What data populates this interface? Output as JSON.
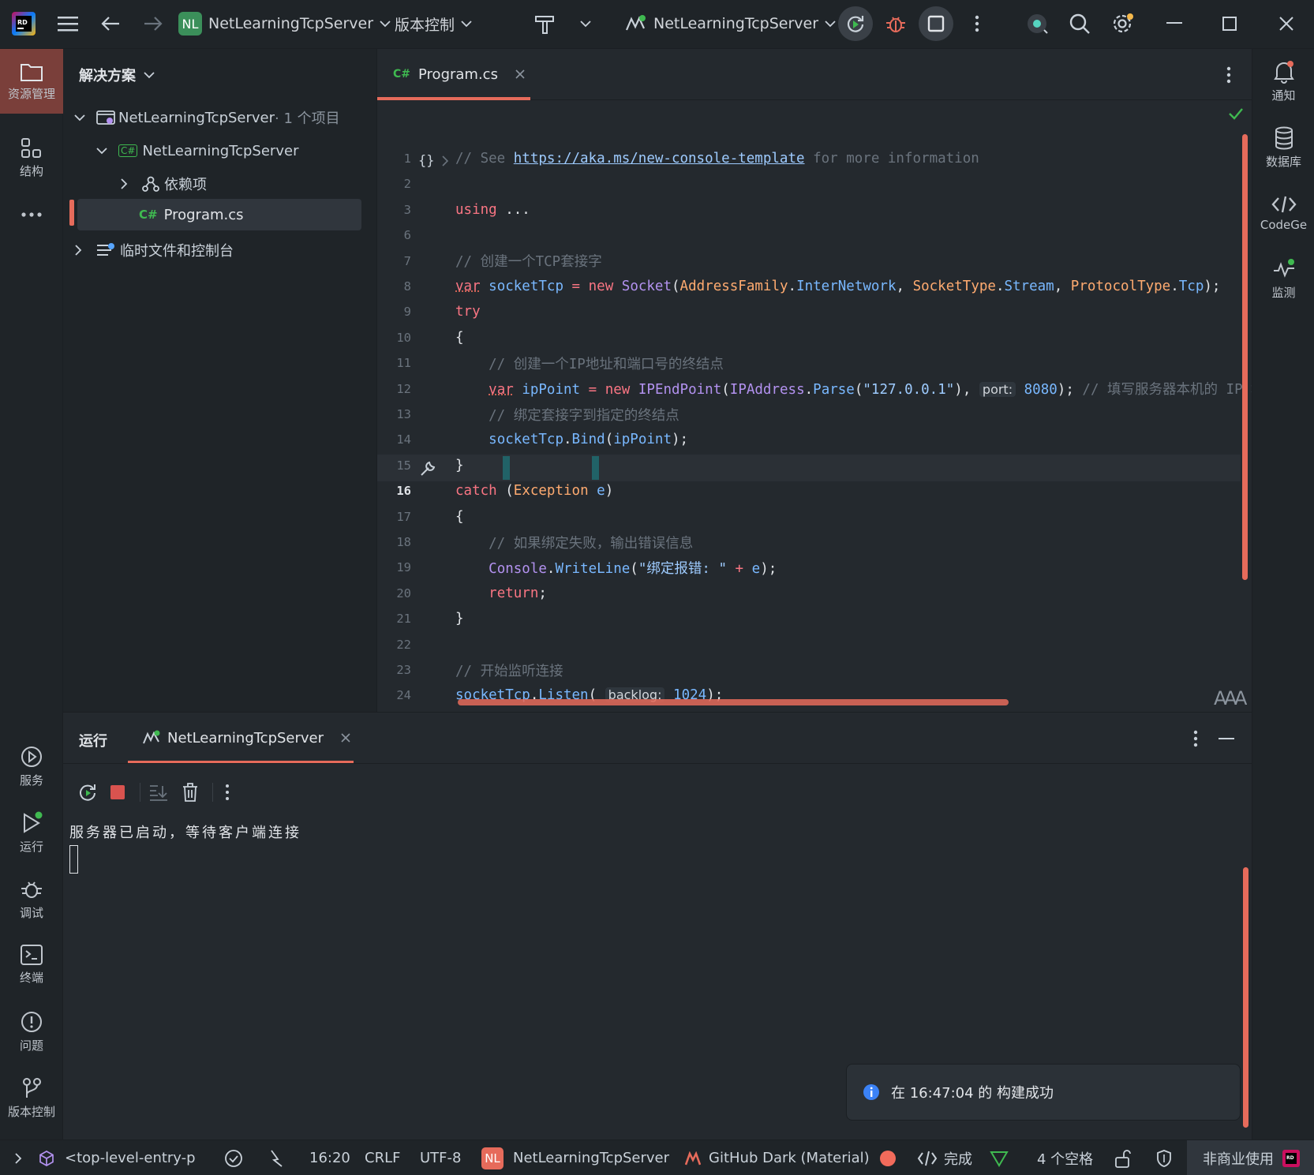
{
  "titlebar": {
    "project_badge": "NL",
    "project_name": "NetLearningTcpServer",
    "vcs_label": "版本控制",
    "run_config": "NetLearningTcpServer"
  },
  "solution": {
    "header": "解决方案",
    "items": [
      {
        "label": "NetLearningTcpServer",
        "suffix": " · 1 个项目"
      },
      {
        "label": "NetLearningTcpServer",
        "badge": "C#"
      },
      {
        "label": "依赖项"
      },
      {
        "label": "Program.cs",
        "badge": "C#"
      },
      {
        "label": "临时文件和控制台"
      }
    ]
  },
  "left_strip": {
    "explorer": "资源管理",
    "structure": "结构",
    "services": "服务",
    "run": "运行",
    "debug": "调试",
    "terminal": "终端",
    "problems": "问题",
    "vcs": "版本控制"
  },
  "right_strip": {
    "notifications": "通知",
    "database": "数据库",
    "codegen": "CodeGe",
    "monitor": "监测"
  },
  "editor": {
    "tab_lang": "C#",
    "tab_label": "Program.cs",
    "current_line": "16",
    "lines": [
      {
        "n": "1",
        "parts": [
          {
            "c": "c-com",
            "t": "// See "
          },
          {
            "c": "c-link",
            "t": "https://aka.ms/new-console-template"
          },
          {
            "c": "c-com",
            "t": " for more information"
          }
        ]
      },
      {
        "n": "2",
        "parts": []
      },
      {
        "n": "3",
        "parts": [
          {
            "c": "c-kw",
            "t": "using"
          },
          {
            "c": "c-plain",
            "t": " ..."
          }
        ]
      },
      {
        "n": "6",
        "parts": []
      },
      {
        "n": "7",
        "parts": [
          {
            "c": "c-com",
            "t": "// 创建一个TCP套接字"
          }
        ]
      },
      {
        "n": "8",
        "parts": [
          {
            "c": "c-kw",
            "t": "var"
          },
          {
            "c": "c-plain",
            "t": " "
          },
          {
            "c": "c-var",
            "t": "socketTcp"
          },
          {
            "c": "c-plain",
            "t": " "
          },
          {
            "c": "c-kw",
            "t": "="
          },
          {
            "c": "c-plain",
            "t": " "
          },
          {
            "c": "c-kw",
            "t": "new"
          },
          {
            "c": "c-plain",
            "t": " "
          },
          {
            "c": "c-type",
            "t": "Socket"
          },
          {
            "c": "c-plain",
            "t": "("
          },
          {
            "c": "c-yel",
            "t": "AddressFamily"
          },
          {
            "c": "c-plain",
            "t": "."
          },
          {
            "c": "c-fn",
            "t": "InterNetwork"
          },
          {
            "c": "c-plain",
            "t": ", "
          },
          {
            "c": "c-yel",
            "t": "SocketType"
          },
          {
            "c": "c-plain",
            "t": "."
          },
          {
            "c": "c-fn",
            "t": "Stream"
          },
          {
            "c": "c-plain",
            "t": ", "
          },
          {
            "c": "c-yel",
            "t": "ProtocolType"
          },
          {
            "c": "c-plain",
            "t": "."
          },
          {
            "c": "c-fn",
            "t": "Tcp"
          },
          {
            "c": "c-plain",
            "t": ");"
          }
        ]
      },
      {
        "n": "9",
        "parts": [
          {
            "c": "c-kw",
            "t": "try"
          }
        ]
      },
      {
        "n": "10",
        "parts": [
          {
            "c": "c-plain",
            "t": "{"
          }
        ]
      },
      {
        "n": "11",
        "parts": [
          {
            "c": "c-com",
            "t": "    // 创建一个IP地址和端口号的终结点"
          }
        ]
      },
      {
        "n": "12",
        "parts": [
          {
            "c": "c-plain",
            "t": "    "
          },
          {
            "c": "c-kw",
            "t": "var"
          },
          {
            "c": "c-plain",
            "t": " "
          },
          {
            "c": "c-var",
            "t": "ipPoint"
          },
          {
            "c": "c-plain",
            "t": " "
          },
          {
            "c": "c-kw",
            "t": "="
          },
          {
            "c": "c-plain",
            "t": " "
          },
          {
            "c": "c-kw",
            "t": "new"
          },
          {
            "c": "c-plain",
            "t": " "
          },
          {
            "c": "c-type",
            "t": "IPEndPoint"
          },
          {
            "c": "c-plain",
            "t": "("
          },
          {
            "c": "c-type",
            "t": "IPAddress"
          },
          {
            "c": "c-plain",
            "t": "."
          },
          {
            "c": "c-fn",
            "t": "Parse"
          },
          {
            "c": "c-plain",
            "t": "("
          },
          {
            "c": "c-str",
            "t": "\"127.0.0.1\""
          },
          {
            "c": "c-plain",
            "t": "), "
          },
          {
            "c": "hint",
            "t": "port:"
          },
          {
            "c": "c-plain",
            "t": " "
          },
          {
            "c": "c-var",
            "t": "8080"
          },
          {
            "c": "c-plain",
            "t": "); "
          },
          {
            "c": "c-com",
            "t": "// 填写服务器本机的 IP 地址"
          }
        ]
      },
      {
        "n": "13",
        "parts": [
          {
            "c": "c-com",
            "t": "    // 绑定套接字到指定的终结点"
          }
        ]
      },
      {
        "n": "14",
        "parts": [
          {
            "c": "c-plain",
            "t": "    "
          },
          {
            "c": "c-var",
            "t": "socketTcp"
          },
          {
            "c": "c-plain",
            "t": "."
          },
          {
            "c": "c-fn",
            "t": "Bind"
          },
          {
            "c": "c-plain",
            "t": "("
          },
          {
            "c": "c-var",
            "t": "ipPoint"
          },
          {
            "c": "c-plain",
            "t": ");"
          }
        ]
      },
      {
        "n": "15",
        "parts": [
          {
            "c": "c-plain",
            "t": "}"
          }
        ]
      },
      {
        "n": "16",
        "parts": [
          {
            "c": "c-kw",
            "t": "catch"
          },
          {
            "c": "c-plain",
            "t": " "
          },
          {
            "c": "c-plain",
            "t": "("
          },
          {
            "c": "c-yel",
            "t": "Exception"
          },
          {
            "c": "c-plain",
            "t": " "
          },
          {
            "c": "c-var",
            "t": "e"
          },
          {
            "c": "c-plain",
            "t": ")"
          }
        ]
      },
      {
        "n": "17",
        "parts": [
          {
            "c": "c-plain",
            "t": "{"
          }
        ]
      },
      {
        "n": "18",
        "parts": [
          {
            "c": "c-com",
            "t": "    // 如果绑定失败，输出错误信息"
          }
        ]
      },
      {
        "n": "19",
        "parts": [
          {
            "c": "c-plain",
            "t": "    "
          },
          {
            "c": "c-type",
            "t": "Console"
          },
          {
            "c": "c-plain",
            "t": "."
          },
          {
            "c": "c-fn",
            "t": "WriteLine"
          },
          {
            "c": "c-plain",
            "t": "("
          },
          {
            "c": "c-str",
            "t": "\"绑定报错: \""
          },
          {
            "c": "c-plain",
            "t": " "
          },
          {
            "c": "c-kw",
            "t": "+"
          },
          {
            "c": "c-plain",
            "t": " "
          },
          {
            "c": "c-var",
            "t": "e"
          },
          {
            "c": "c-plain",
            "t": ");"
          }
        ]
      },
      {
        "n": "20",
        "parts": [
          {
            "c": "c-plain",
            "t": "    "
          },
          {
            "c": "c-kw",
            "t": "return"
          },
          {
            "c": "c-plain",
            "t": ";"
          }
        ]
      },
      {
        "n": "21",
        "parts": [
          {
            "c": "c-plain",
            "t": "}"
          }
        ]
      },
      {
        "n": "22",
        "parts": []
      },
      {
        "n": "23",
        "parts": [
          {
            "c": "c-com",
            "t": "// 开始监听连接"
          }
        ]
      },
      {
        "n": "24",
        "parts": [
          {
            "c": "c-var",
            "t": "socketTcp"
          },
          {
            "c": "c-plain",
            "t": "."
          },
          {
            "c": "c-fn",
            "t": "Listen"
          },
          {
            "c": "c-plain",
            "t": "( "
          },
          {
            "c": "hint",
            "t": "backlog:"
          },
          {
            "c": "c-plain",
            "t": " "
          },
          {
            "c": "c-var",
            "t": "1024"
          },
          {
            "c": "c-plain",
            "t": ");"
          }
        ]
      }
    ]
  },
  "run_panel": {
    "title": "运行",
    "tab_label": "NetLearningTcpServer",
    "output": "服务器已启动，等待客户端连接"
  },
  "notification": {
    "pre": "在 ",
    "time": "16:47:04",
    "post": " 的 构建成功"
  },
  "statusbar": {
    "breadcrumb": "<top-level-entry-p",
    "position": "16:20",
    "line_sep": "CRLF",
    "encoding": "UTF-8",
    "project_badge": "NL",
    "project": "NetLearningTcpServer",
    "theme": "GitHub Dark (Material)",
    "codegen_status": "完成",
    "indent": "4 个空格",
    "license": "非商业使用"
  },
  "colors": {
    "accent": "#e66b5b",
    "background": "#24292e",
    "panel": "#1f2428",
    "success": "#3fb950",
    "info": "#3b82f6"
  }
}
